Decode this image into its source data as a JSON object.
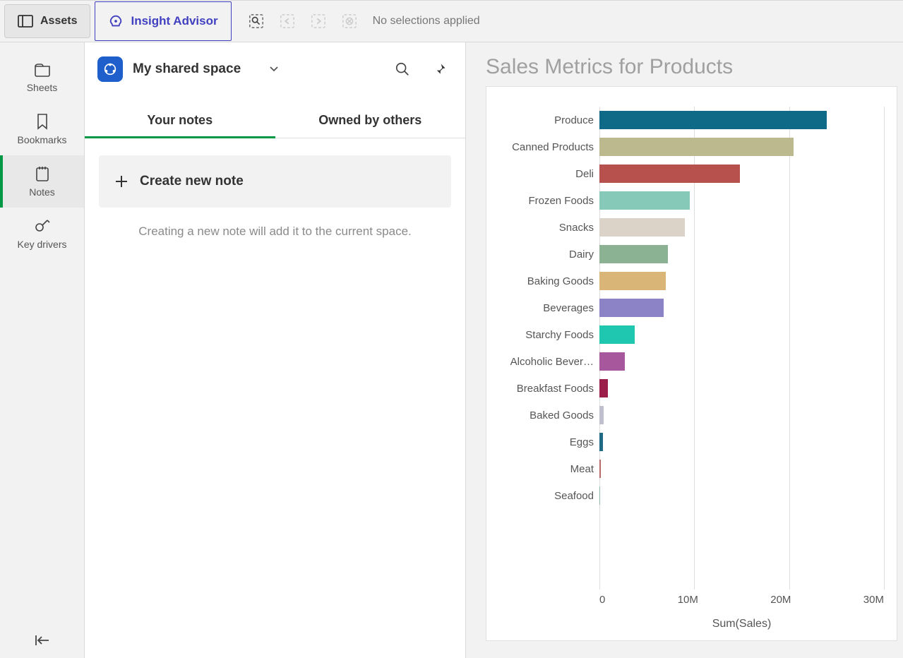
{
  "topbar": {
    "assets_label": "Assets",
    "insight_label": "Insight Advisor",
    "selections_text": "No selections applied"
  },
  "sidebar": {
    "items": [
      {
        "label": "Sheets"
      },
      {
        "label": "Bookmarks"
      },
      {
        "label": "Notes"
      },
      {
        "label": "Key drivers"
      }
    ]
  },
  "notes_panel": {
    "space_name": "My shared space",
    "tabs": [
      {
        "label": "Your notes",
        "active": true
      },
      {
        "label": "Owned by others",
        "active": false
      }
    ],
    "create_label": "Create new note",
    "hint": "Creating a new note will add it to the current space."
  },
  "chart": {
    "title": "Sales Metrics for Products",
    "xlabel": "Sum(Sales)"
  },
  "chart_data": {
    "type": "bar",
    "orientation": "horizontal",
    "title": "Sales Metrics for Products",
    "xlabel": "Sum(Sales)",
    "xlim": [
      0,
      30000000
    ],
    "xticks": [
      "0",
      "10M",
      "20M",
      "30M"
    ],
    "categories": [
      "Produce",
      "Canned Products",
      "Deli",
      "Frozen Foods",
      "Snacks",
      "Dairy",
      "Baking Goods",
      "Beverages",
      "Starchy Foods",
      "Alcoholic Bever…",
      "Breakfast Foods",
      "Baked Goods",
      "Eggs",
      "Meat",
      "Seafood"
    ],
    "values": [
      24000000,
      20500000,
      14800000,
      9500000,
      9000000,
      7200000,
      7000000,
      6800000,
      3700000,
      2700000,
      900000,
      450000,
      400000,
      120000,
      60000
    ],
    "colors": [
      "#0e6a87",
      "#bcb98f",
      "#b7514d",
      "#86c9b8",
      "#dcd3c8",
      "#8bb293",
      "#d9b677",
      "#8b83c6",
      "#1fc7b0",
      "#a7579c",
      "#9a1d4a",
      "#bfbfcf",
      "#216a86",
      "#b76b68",
      "#8fb6a8"
    ]
  }
}
